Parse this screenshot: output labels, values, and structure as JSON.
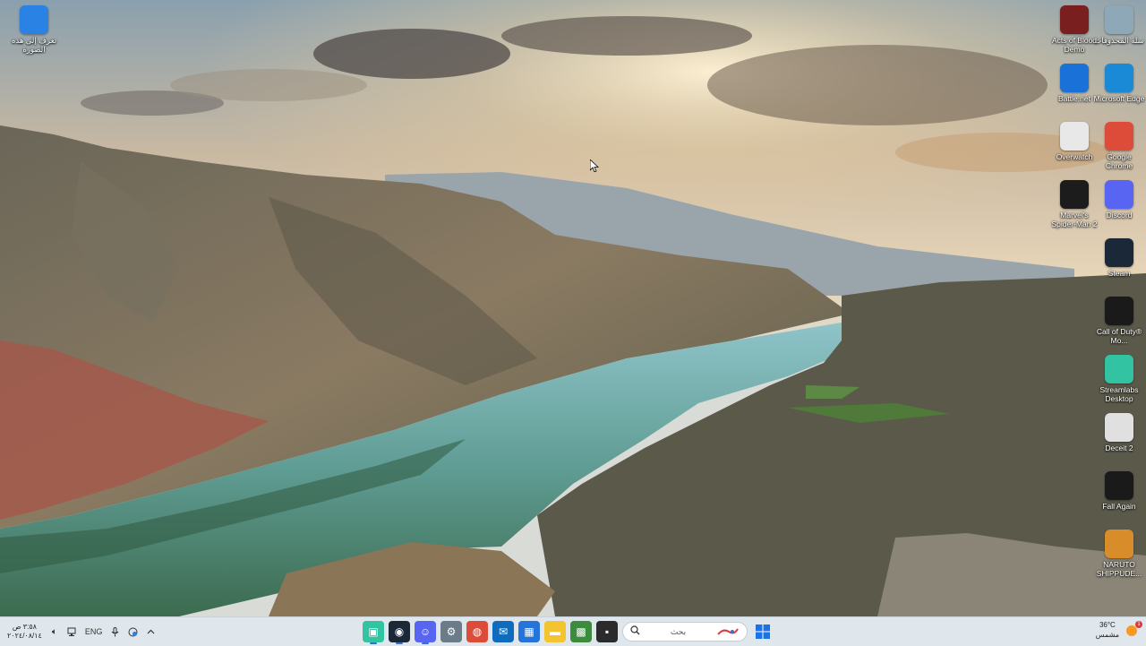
{
  "desktop": {
    "left_icons": [
      {
        "label": "تعرف إلى هذه الصورة",
        "icon": "info-icon",
        "color": "#2a82e4"
      }
    ],
    "right_icons": [
      {
        "label": "سلة المحذوفات",
        "icon": "recycle-bin-icon",
        "color": "#8fa8b8"
      },
      {
        "label": "Acts of Blood Demo",
        "icon": "acts-of-blood-icon",
        "color": "#7a1f1f"
      },
      {
        "label": "Microsoft Edge",
        "icon": "edge-icon",
        "color": "#1b8ad6"
      },
      {
        "label": "Battle.net",
        "icon": "battlenet-icon",
        "color": "#1a72d8"
      },
      {
        "label": "Google Chrome",
        "icon": "chrome-icon",
        "color": "#dd4b39"
      },
      {
        "label": "Overwatch",
        "icon": "overwatch-icon",
        "color": "#e8e8e8"
      },
      {
        "label": "Discord",
        "icon": "discord-icon",
        "color": "#5865f2"
      },
      {
        "label": "Marvel's Spider-Man 2",
        "icon": "spiderman-icon",
        "color": "#1c1c1c"
      },
      {
        "label": "Steam",
        "icon": "steam-icon",
        "color": "#1b2838"
      },
      {
        "label": "Call of Duty® Mo...",
        "icon": "call-of-duty-icon",
        "color": "#1a1a1a"
      },
      {
        "label": "Streamlabs Desktop",
        "icon": "streamlabs-icon",
        "color": "#31c3a2"
      },
      {
        "label": "Deceit 2",
        "icon": "deceit-icon",
        "color": "#e0e0e0"
      },
      {
        "label": "Fall Again",
        "icon": "fall-again-icon",
        "color": "#1a1a1a"
      },
      {
        "label": "NARUTO SHIPPUDE...",
        "icon": "naruto-icon",
        "color": "#d88c2a"
      }
    ]
  },
  "taskbar": {
    "clock_time": "٣:٥٨ ص",
    "clock_date": "٢٠٢٤/٠٨/١٤",
    "language": "ENG",
    "search_placeholder": "بحث",
    "weather_temp": "36°C",
    "weather_desc": "مشمس",
    "notification_count": "1",
    "apps": [
      {
        "name": "taskbar-streamlabs",
        "icon": "streamlabs-icon",
        "color": "#31c3a2",
        "glyph": "▣",
        "active": true
      },
      {
        "name": "taskbar-steam",
        "icon": "steam-icon",
        "color": "#1b2838",
        "glyph": "◉",
        "active": true
      },
      {
        "name": "taskbar-discord",
        "icon": "discord-icon",
        "color": "#5865f2",
        "glyph": "☺",
        "active": true
      },
      {
        "name": "taskbar-settings",
        "icon": "gear-icon",
        "color": "#6b7b88",
        "glyph": "⚙",
        "active": false
      },
      {
        "name": "taskbar-chrome",
        "icon": "chrome-icon",
        "color": "#dd4b39",
        "glyph": "◍",
        "active": false
      },
      {
        "name": "taskbar-outlook",
        "icon": "outlook-icon",
        "color": "#0f6cbd",
        "glyph": "✉",
        "active": false
      },
      {
        "name": "taskbar-store",
        "icon": "store-icon",
        "color": "#2574d9",
        "glyph": "▦",
        "active": false
      },
      {
        "name": "taskbar-file-explorer",
        "icon": "folder-icon",
        "color": "#f4c430",
        "glyph": "▬",
        "active": false
      },
      {
        "name": "taskbar-xbox-app",
        "icon": "xbox-icon",
        "color": "#3d8b3d",
        "glyph": "▩",
        "active": false
      },
      {
        "name": "taskbar-terminal",
        "icon": "terminal-icon",
        "color": "#2b2b2b",
        "glyph": "▪",
        "active": false
      }
    ]
  }
}
